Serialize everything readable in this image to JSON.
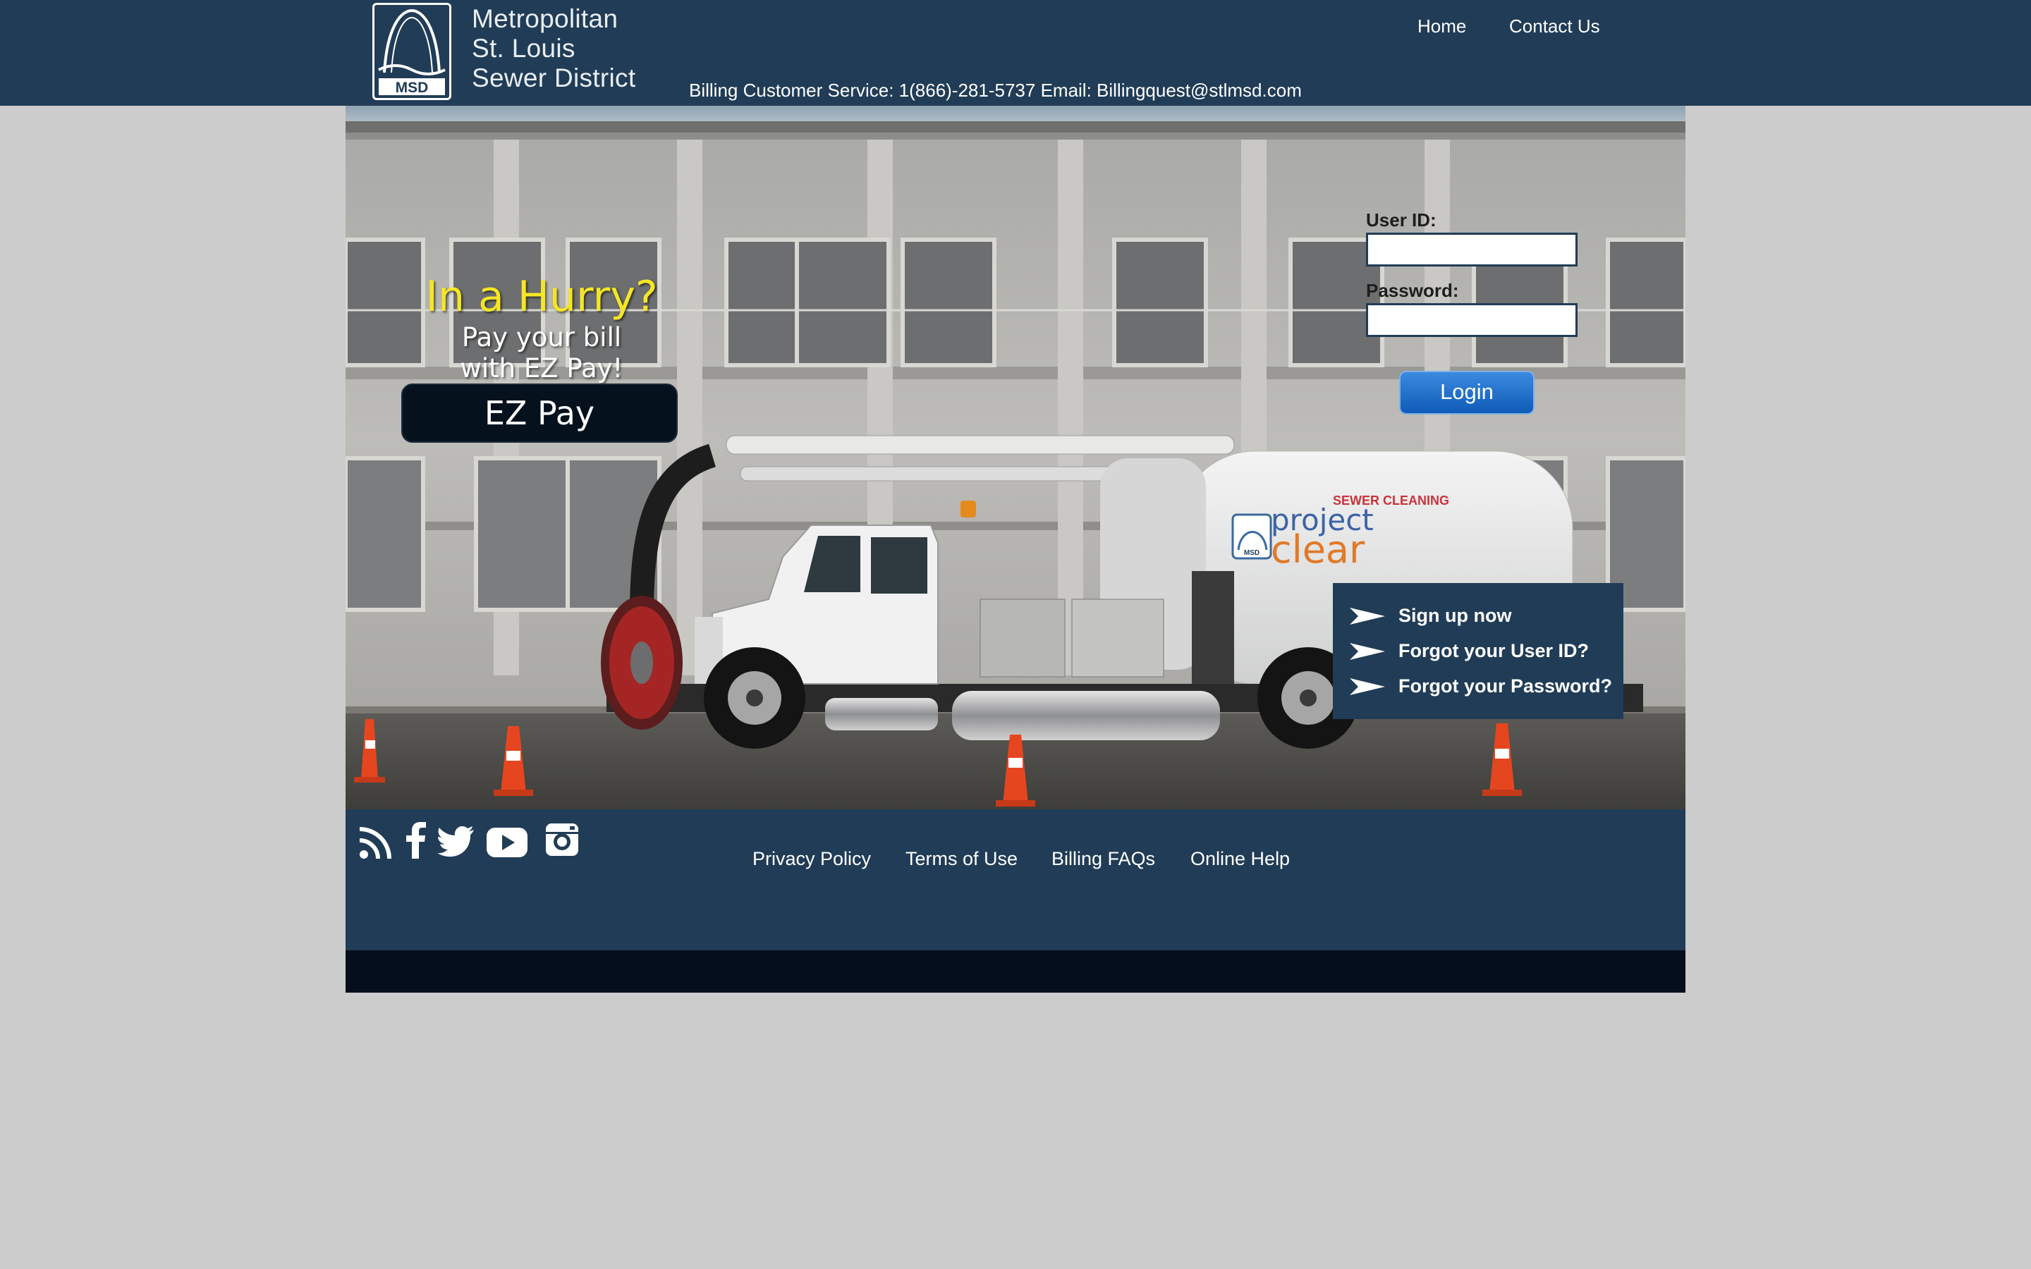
{
  "header": {
    "logo_abbrev": "MSD",
    "logo_lines": [
      "Metropolitan",
      "St. Louis",
      "Sewer District"
    ],
    "nav": {
      "home": "Home",
      "contact": "Contact Us"
    },
    "service_line": "Billing Customer Service: 1(866)-281-5737 Email: Billingquest@stlmsd.com"
  },
  "promo": {
    "headline": "In a Hurry?",
    "sub_lines": [
      "Pay your bill",
      "with EZ Pay!"
    ],
    "button": "EZ Pay"
  },
  "login": {
    "user_label": "User ID:",
    "user_value": "",
    "password_label": "Password:",
    "password_value": "",
    "button": "Login"
  },
  "links": [
    "Sign up now",
    "Forgot your User ID?",
    "Forgot your Password?"
  ],
  "truck": {
    "side_heading": "SEWER CLEANING",
    "brand_line1": "project",
    "brand_line2": "clear",
    "emblem": "MSD"
  },
  "social_icons": [
    "rss-icon",
    "facebook-icon",
    "twitter-icon",
    "youtube-icon",
    "instagram-icon"
  ],
  "footer": {
    "links": [
      "Privacy Policy",
      "Terms of Use",
      "Billing FAQs",
      "Online Help"
    ]
  },
  "colors": {
    "header_bg": "#213c56",
    "page_bg": "#cccccc",
    "footer_bottom": "#040e1d",
    "promo_yellow": "#f5e625",
    "login_blue": "#1a6fd0"
  }
}
